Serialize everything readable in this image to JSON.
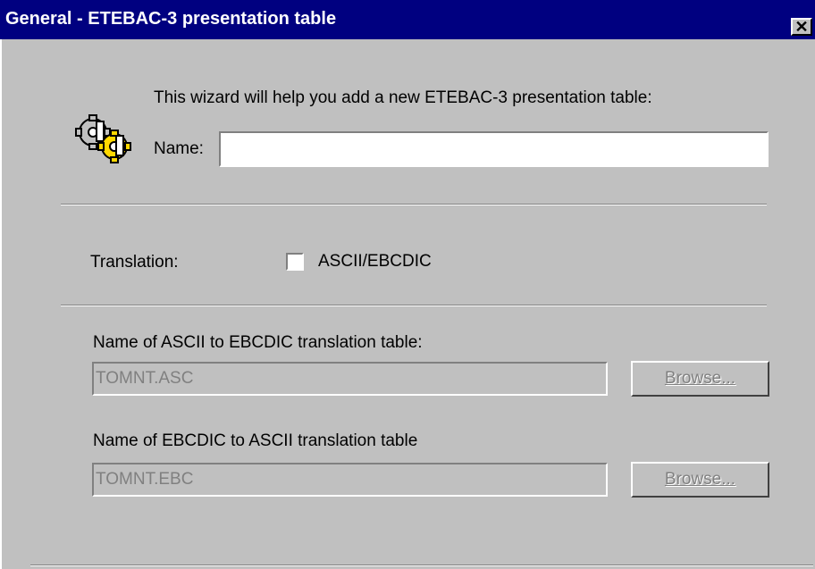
{
  "window": {
    "title": "General - ETEBAC-3 presentation table",
    "close_glyph": "✕",
    "icon": "gears-icon"
  },
  "intro_text": "This wizard will help you add a new ETEBAC-3 presentation table:",
  "name_field": {
    "label": "Name:",
    "value": ""
  },
  "translation": {
    "label": "Translation:",
    "checkbox_label": "ASCII/EBCDIC",
    "checked": false
  },
  "ascii_to_ebcdic": {
    "label": "Name of ASCII to EBCDIC translation table:",
    "value": "TOMNT.ASC",
    "browse_label": "Browse...",
    "enabled": false
  },
  "ebcdic_to_ascii": {
    "label": "Name of EBCDIC to ASCII translation table",
    "value": "TOMNT.EBC",
    "browse_label": "Browse...",
    "enabled": false
  },
  "colors": {
    "titlebar": "#000080",
    "face": "#c0c0c0",
    "disabled_text": "#808080"
  }
}
